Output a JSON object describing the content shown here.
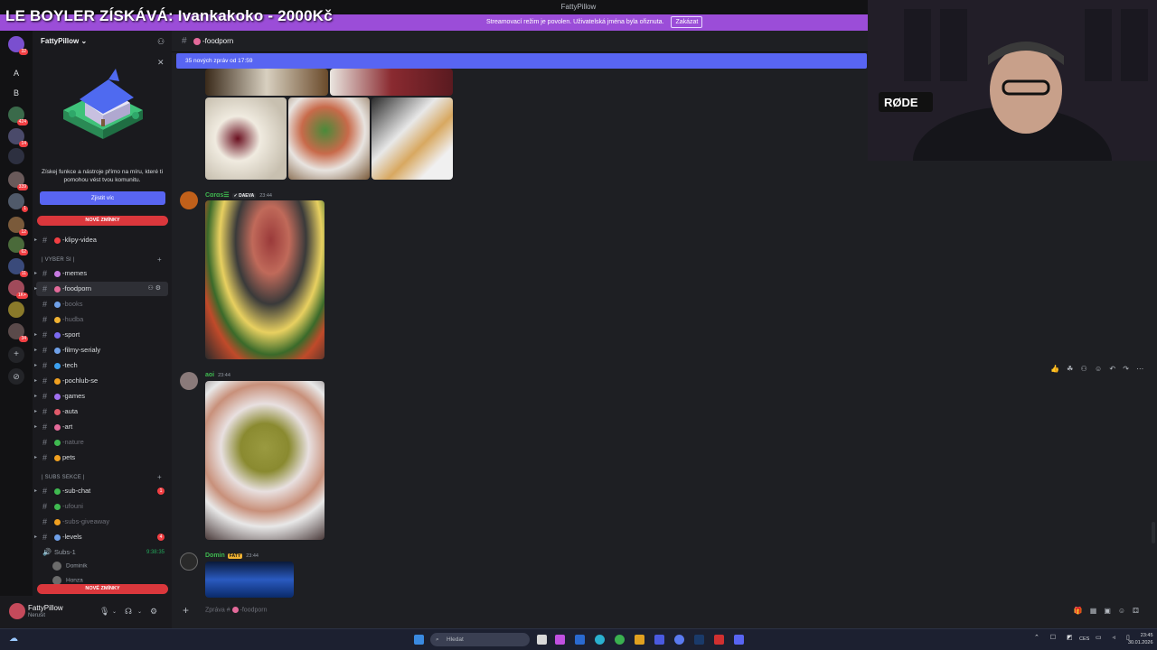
{
  "window": {
    "title": "FattyPillow"
  },
  "overlay": {
    "title": "LE BOYLER ZÍSKÁVÁ: Ivankakoko - 2000Kč"
  },
  "stream_banner": {
    "text": "Streamovací režim je povolen. Uživatelská jména byla ořiznuta.",
    "button": "Zakázat"
  },
  "server": {
    "name": "FattyPillow ⌄"
  },
  "guild_letters": [
    "A",
    "B"
  ],
  "promo": {
    "text": "Získej funkce a nástroje přímo na míru, které ti pomohou vést tvou komunitu.",
    "button": "Zjistit víc"
  },
  "new_mentions": "NOVÉ ZMÍNKY",
  "categories": {
    "vyber_si": "| VYBER SI |",
    "subs_sekce": "| SUBS SEKCE |"
  },
  "channels": [
    {
      "name": "-klipy-videa",
      "muted": false,
      "color": "#f23f43"
    },
    {
      "name": "-memes",
      "muted": false,
      "color": "#c679e0"
    },
    {
      "name": "-foodporn",
      "muted": false,
      "color": "#e46a9a",
      "active": true
    },
    {
      "name": "-books",
      "muted": true,
      "color": "#6fa0e8"
    },
    {
      "name": "-hudba",
      "muted": true,
      "color": "#f0b232"
    },
    {
      "name": "-sport",
      "muted": false,
      "color": "#7a6af0"
    },
    {
      "name": "-filmy-serialy",
      "muted": false,
      "color": "#6fa0e8"
    },
    {
      "name": "-tech",
      "muted": false,
      "color": "#3ba0f0"
    },
    {
      "name": "-pochlub-se",
      "muted": false,
      "color": "#f0a020"
    },
    {
      "name": "-games",
      "muted": false,
      "color": "#a070f0"
    },
    {
      "name": "-auta",
      "muted": false,
      "color": "#e05a6a"
    },
    {
      "name": "-art",
      "muted": false,
      "color": "#e46a9a"
    },
    {
      "name": "-nature",
      "muted": true,
      "color": "#3fb950"
    },
    {
      "name": "pets",
      "muted": false,
      "color": "#f0a020"
    },
    {
      "name": "-sub-chat",
      "muted": false,
      "color": "#3fb950",
      "badge": "1"
    },
    {
      "name": "-ufouni",
      "muted": true,
      "color": "#3fb950"
    },
    {
      "name": "-subs-giveaway",
      "muted": true,
      "color": "#f0a020"
    },
    {
      "name": "-levels",
      "muted": false,
      "color": "#6fa0e8",
      "badge": "4"
    }
  ],
  "voice": {
    "name": "Subs-1",
    "time": "9:38:35",
    "users": [
      "Dominik",
      "Honza"
    ]
  },
  "user": {
    "name": "FattyPillow",
    "status": "Nerušit"
  },
  "chat": {
    "channel": "-foodporn",
    "new_messages": "35 nových zpráv od 17:59",
    "messages": [
      {
        "author": "Cɑrɑs☰",
        "tag": "✓ DAEVA",
        "time": "23:44",
        "color": "#3fb950"
      },
      {
        "author": "aoi",
        "tag": "",
        "time": "23:44",
        "color": "#3fb950"
      },
      {
        "author": "Domin",
        "tag": "FATY",
        "time": "23:44",
        "color": "#3fb950"
      }
    ],
    "input_placeholder": "Zpráva #",
    "input_channel": "-foodporn"
  },
  "webcam": {
    "mic_brand": "RØDE"
  },
  "taskbar": {
    "search": "Hledat",
    "lang": "CES",
    "time": "23:45",
    "date": "30.01.2026"
  }
}
